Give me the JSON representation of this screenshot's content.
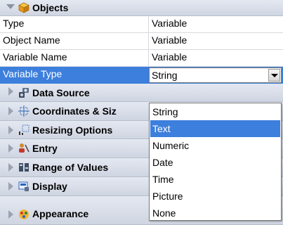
{
  "header": {
    "title": "Objects",
    "icon": "cube-icon"
  },
  "properties": [
    {
      "label": "Type",
      "value": "Variable"
    },
    {
      "label": "Object Name",
      "value": "Variable"
    },
    {
      "label": "Variable Name",
      "value": "Variable"
    },
    {
      "label": "Variable Type",
      "value": "String",
      "selected": true
    }
  ],
  "groups": [
    {
      "label": "Data Source",
      "icon": "data-source-icon"
    },
    {
      "label": "Coordinates & Siz",
      "icon": "coordinates-icon"
    },
    {
      "label": "Resizing Options",
      "icon": "resize-icon"
    },
    {
      "label": "Entry",
      "icon": "entry-icon"
    },
    {
      "label": "Range of Values",
      "icon": "range-icon"
    },
    {
      "label": "Display",
      "icon": "display-icon"
    },
    {
      "label": "Appearance",
      "icon": "appearance-icon"
    }
  ],
  "dropdown": {
    "options": [
      "String",
      "Text",
      "Numeric",
      "Date",
      "Time",
      "Picture",
      "None"
    ],
    "highlighted": "Text"
  },
  "colors": {
    "selection": "#3c7fdc",
    "group_bg": "#d6dbe6",
    "grid_line": "#d6d9de"
  }
}
